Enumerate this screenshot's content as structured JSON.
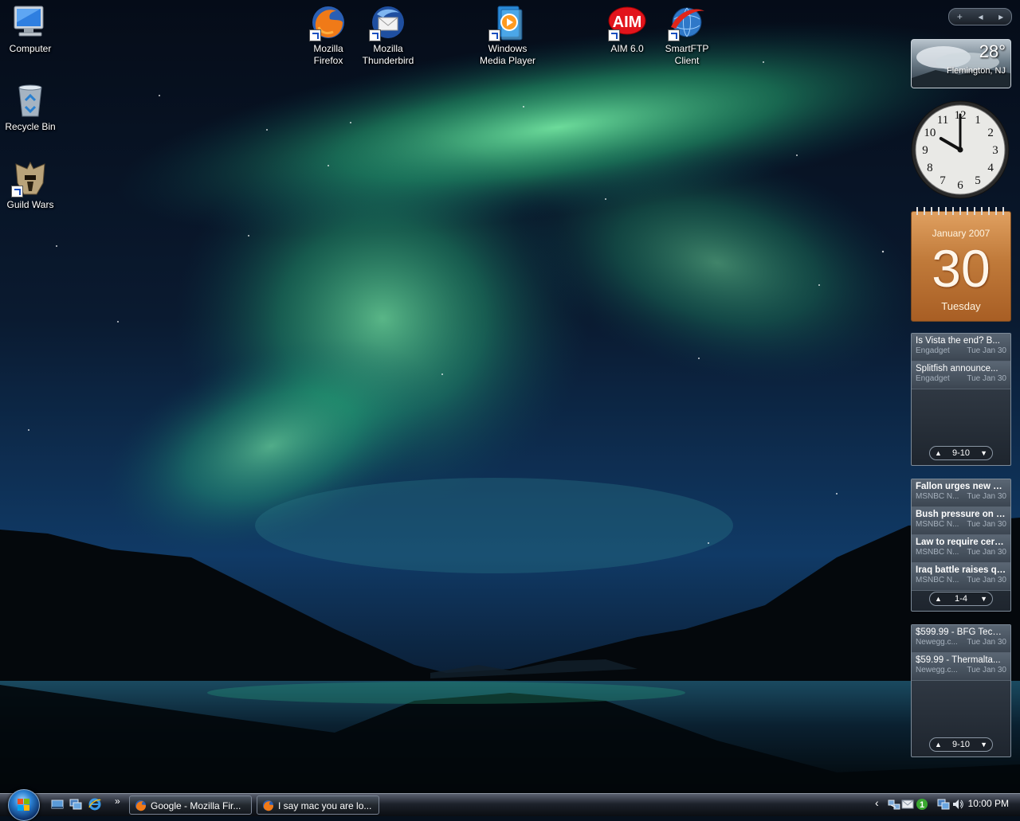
{
  "desktop": {
    "icons_left": [
      {
        "label": "Computer",
        "icon": "computer-icon"
      },
      {
        "label": "Recycle Bin",
        "icon": "recycle-bin-icon"
      },
      {
        "label": "Guild Wars",
        "icon": "guild-wars-icon"
      }
    ],
    "icons_top": [
      {
        "label": "Mozilla\nFirefox",
        "icon": "firefox-icon"
      },
      {
        "label": "Mozilla\nThunderbird",
        "icon": "thunderbird-icon"
      },
      {
        "label": "Windows\nMedia Player",
        "icon": "media-player-icon"
      },
      {
        "label": "AIM 6.0",
        "icon": "aim-icon"
      },
      {
        "label": "SmartFTP\nClient",
        "icon": "smartftp-icon"
      }
    ]
  },
  "sidebar": {
    "controls": {
      "add": "+",
      "prev": "◂",
      "next": "▸"
    },
    "weather": {
      "temperature": "28°",
      "location": "Flemington, NJ"
    },
    "clock": {
      "numerals": [
        "12",
        "1",
        "2",
        "3",
        "4",
        "5",
        "6",
        "7",
        "8",
        "9",
        "10",
        "11"
      ],
      "hour": 10,
      "minute": 0
    },
    "calendar": {
      "month_year": "January 2007",
      "day": "30",
      "weekday": "Tuesday"
    },
    "feeds": [
      {
        "items": [
          {
            "title": "Is Vista the end? B...",
            "source": "Engadget",
            "date": "Tue Jan 30",
            "bold": false
          },
          {
            "title": "Splitfish announce...",
            "source": "Engadget",
            "date": "Tue Jan 30",
            "bold": false
          }
        ],
        "pager": "9-10"
      },
      {
        "items": [
          {
            "title": "Fallon urges new act...",
            "source": "MSNBC N...",
            "date": "Tue Jan 30",
            "bold": true
          },
          {
            "title": "Bush pressure on cli...",
            "source": "MSNBC N...",
            "date": "Tue Jan 30",
            "bold": true
          },
          {
            "title": "Law to require cervic...",
            "source": "MSNBC N...",
            "date": "Tue Jan 30",
            "bold": true
          },
          {
            "title": "Iraq battle raises que...",
            "source": "MSNBC N...",
            "date": "Tue Jan 30",
            "bold": true
          }
        ],
        "pager": "1-4"
      },
      {
        "items": [
          {
            "title": "$599.99 - BFG Tech ...",
            "source": "Newegg.c...",
            "date": "Tue Jan 30",
            "bold": false
          },
          {
            "title": "$59.99 - Thermalta...",
            "source": "Newegg.c...",
            "date": "Tue Jan 30",
            "bold": false
          }
        ],
        "pager": "9-10"
      }
    ]
  },
  "taskbar": {
    "quick_launch_chevron": "»",
    "tasks": [
      {
        "label": "Google - Mozilla Fir...",
        "icon": "firefox-icon"
      },
      {
        "label": "I say mac you are lo...",
        "icon": "firefox-icon"
      }
    ],
    "tray_chevron": "‹",
    "time": "10:00 PM"
  }
}
